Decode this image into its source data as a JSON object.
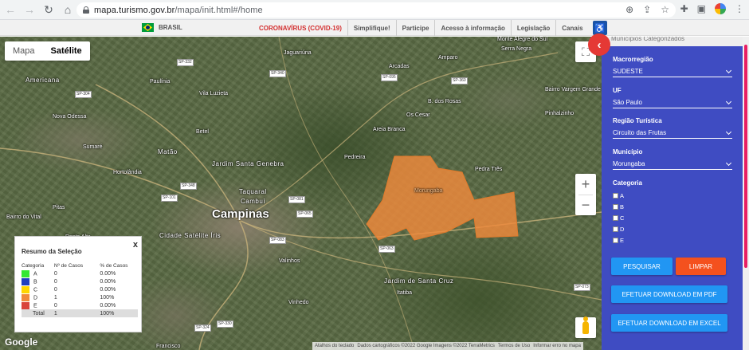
{
  "browser": {
    "url_host": "mapa.turismo.gov.br",
    "url_path": "/mapa/init.html#/home",
    "nav_icons": [
      "back-arrow-icon",
      "forward-arrow-icon",
      "reload-icon",
      "home-icon"
    ]
  },
  "govbar": {
    "country": "BRASIL",
    "links": [
      "CORONAVÍRUS (COVID-19)",
      "Simplifique!",
      "Participe",
      "Acesso à informação",
      "Legislação",
      "Canais"
    ],
    "accent": "#d32f2f"
  },
  "map": {
    "type_buttons": [
      "Mapa",
      "Satélite"
    ],
    "active_type": "Satélite",
    "logo": "Google",
    "attribution": [
      "Atalhos do teclado",
      "Dados cartográficos ©2022 Google Imagens ©2022 TerraMetrics",
      "Termos de Uso",
      "Informar erro no mapa"
    ],
    "polygon_label": "Morungaba",
    "cities": [
      {
        "name": "Campinas",
        "size": "big"
      },
      {
        "name": "Americana",
        "size": "med"
      },
      {
        "name": "Nova Odessa",
        "size": "sm"
      },
      {
        "name": "Sumaré",
        "size": "sm"
      },
      {
        "name": "Hortolândia",
        "size": "sm"
      },
      {
        "name": "Paulínia",
        "size": "sm"
      },
      {
        "name": "Vila Luzieta",
        "size": "sm"
      },
      {
        "name": "Jaguariúna",
        "size": "sm"
      },
      {
        "name": "Arcadas",
        "size": "sm"
      },
      {
        "name": "Amparo",
        "size": "sm"
      },
      {
        "name": "Monte Alegre do Sul",
        "size": "sm"
      },
      {
        "name": "Serra Negra",
        "size": "sm"
      },
      {
        "name": "Bairro Vargem Grande",
        "size": "sm"
      },
      {
        "name": "Pinhalzinho",
        "size": "sm"
      },
      {
        "name": "B. dos Rosas",
        "size": "sm"
      },
      {
        "name": "Os Cesar",
        "size": "sm"
      },
      {
        "name": "Areia Branca",
        "size": "sm"
      },
      {
        "name": "Pedreira",
        "size": "sm"
      },
      {
        "name": "Matão",
        "size": "med"
      },
      {
        "name": "Betel",
        "size": "sm"
      },
      {
        "name": "Jardim Santa Genebra",
        "size": "med"
      },
      {
        "name": "Taquaral",
        "size": "med"
      },
      {
        "name": "Cambuí",
        "size": "med"
      },
      {
        "name": "Cidade Satélite Íris",
        "size": "med"
      },
      {
        "name": "Valinhos",
        "size": "sm"
      },
      {
        "name": "Vinhedo",
        "size": "sm"
      },
      {
        "name": "Jardim de Santa Cruz",
        "size": "med"
      },
      {
        "name": "Itatiba",
        "size": "sm"
      },
      {
        "name": "Pitas",
        "size": "sm"
      },
      {
        "name": "Bairro do Vital",
        "size": "sm"
      },
      {
        "name": "Ponte Alta",
        "size": "sm"
      },
      {
        "name": "Pedra Três",
        "size": "sm"
      },
      {
        "name": "Francisco",
        "size": "sm"
      }
    ],
    "highways": [
      "SP-332",
      "SP-340",
      "SP-095",
      "SP-360",
      "SP-304",
      "SP-348",
      "SP-101",
      "SP-081",
      "SP-065",
      "SP-083",
      "SP-063",
      "SP-073",
      "SP-324",
      "SP-330"
    ]
  },
  "summary": {
    "title": "Resumo da Seleção",
    "close": "x",
    "headers": [
      "Categoria",
      "Nº de Casos",
      "% de Casos"
    ],
    "rows": [
      {
        "cat": "A",
        "count": "0",
        "pct": "0.00%",
        "color": "#33e833"
      },
      {
        "cat": "B",
        "count": "0",
        "pct": "0.00%",
        "color": "#1e3fbf"
      },
      {
        "cat": "C",
        "count": "0",
        "pct": "0.00%",
        "color": "#ffd600"
      },
      {
        "cat": "D",
        "count": "1",
        "pct": "100%",
        "color": "#f08a3c"
      },
      {
        "cat": "E",
        "count": "0",
        "pct": "0.00%",
        "color": "#d9443a"
      }
    ],
    "total": {
      "label": "Total",
      "count": "1",
      "pct": "100%"
    }
  },
  "sidebar": {
    "top_title": "Municípios Categorizados",
    "background": "#3f4cc2",
    "fields": [
      {
        "label": "Macrorregião",
        "value": "SUDESTE"
      },
      {
        "label": "UF",
        "value": "São Paulo"
      },
      {
        "label": "Região Turística",
        "value": "Circuito das Frutas"
      },
      {
        "label": "Município",
        "value": "Morungaba"
      }
    ],
    "category_label": "Categoria",
    "categories": [
      "A",
      "B",
      "C",
      "D",
      "E"
    ],
    "buttons": {
      "search": "PESQUISAR",
      "clear": "LIMPAR",
      "pdf": "EFETUAR DOWNLOAD EM PDF",
      "excel": "EFETUAR DOWNLOAD EM EXCEL"
    }
  }
}
